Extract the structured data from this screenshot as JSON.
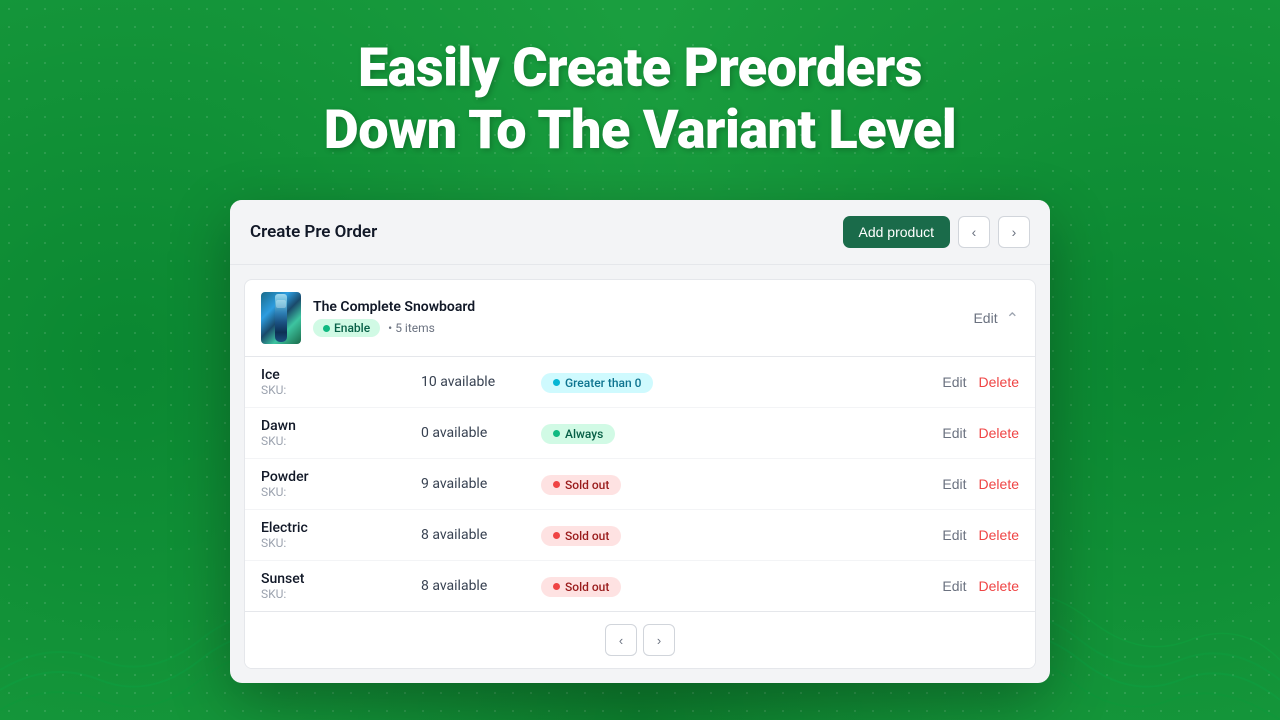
{
  "background": {
    "color": "#1a9e3f"
  },
  "headline": {
    "line1": "Easily Create Preorders",
    "line2": "Down To The Variant Level"
  },
  "app": {
    "title": "Create Pre Order",
    "add_product_label": "Add product",
    "product": {
      "name": "The Complete Snowboard",
      "status_badge": "Enable",
      "items_count": "5 items",
      "edit_label": "Edit"
    },
    "variants": [
      {
        "name": "Ice",
        "sku_label": "SKU:",
        "sku_value": "",
        "stock": "10 available",
        "tag_type": "greater",
        "tag_label": "Greater than 0",
        "edit_label": "Edit",
        "delete_label": "Delete"
      },
      {
        "name": "Dawn",
        "sku_label": "SKU:",
        "sku_value": "",
        "stock": "0 available",
        "tag_type": "always",
        "tag_label": "Always",
        "edit_label": "Edit",
        "delete_label": "Delete"
      },
      {
        "name": "Powder",
        "sku_label": "SKU:",
        "sku_value": "",
        "stock": "9 available",
        "tag_type": "sold-out",
        "tag_label": "Sold out",
        "edit_label": "Edit",
        "delete_label": "Delete"
      },
      {
        "name": "Electric",
        "sku_label": "SKU:",
        "sku_value": "",
        "stock": "8 available",
        "tag_type": "sold-out",
        "tag_label": "Sold out",
        "edit_label": "Edit",
        "delete_label": "Delete"
      },
      {
        "name": "Sunset",
        "sku_label": "SKU:",
        "sku_value": "",
        "stock": "8 available",
        "tag_type": "sold-out",
        "tag_label": "Sold out",
        "edit_label": "Edit",
        "delete_label": "Delete"
      }
    ]
  }
}
